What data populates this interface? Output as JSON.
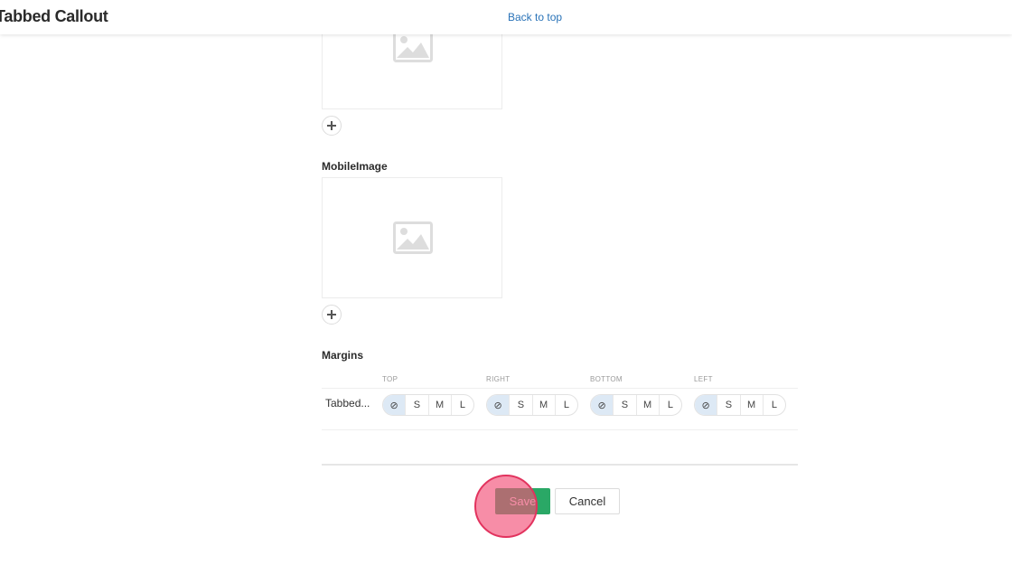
{
  "header": {
    "title": "Tabbed Callout",
    "back_to_top": "Back to top"
  },
  "fields": {
    "mobile_image_label": "MobileImage",
    "margins_label": "Margins"
  },
  "margins": {
    "columns": [
      "TOP",
      "RIGHT",
      "BOTTOM",
      "LEFT"
    ],
    "row_label": "Tabbed...",
    "options": [
      "⊘",
      "S",
      "M",
      "L"
    ],
    "selected": [
      "none",
      "none",
      "none",
      "none"
    ]
  },
  "actions": {
    "save_label": "Save",
    "cancel_label": "Cancel"
  },
  "icons": {
    "placeholder": "image-placeholder-icon",
    "add": "plus-icon",
    "none": "no-margin-icon"
  },
  "colors": {
    "save": "#2aa866",
    "selected_option": "#dde9f5",
    "link": "#2a73b8",
    "click_marker": "#e2335e"
  }
}
